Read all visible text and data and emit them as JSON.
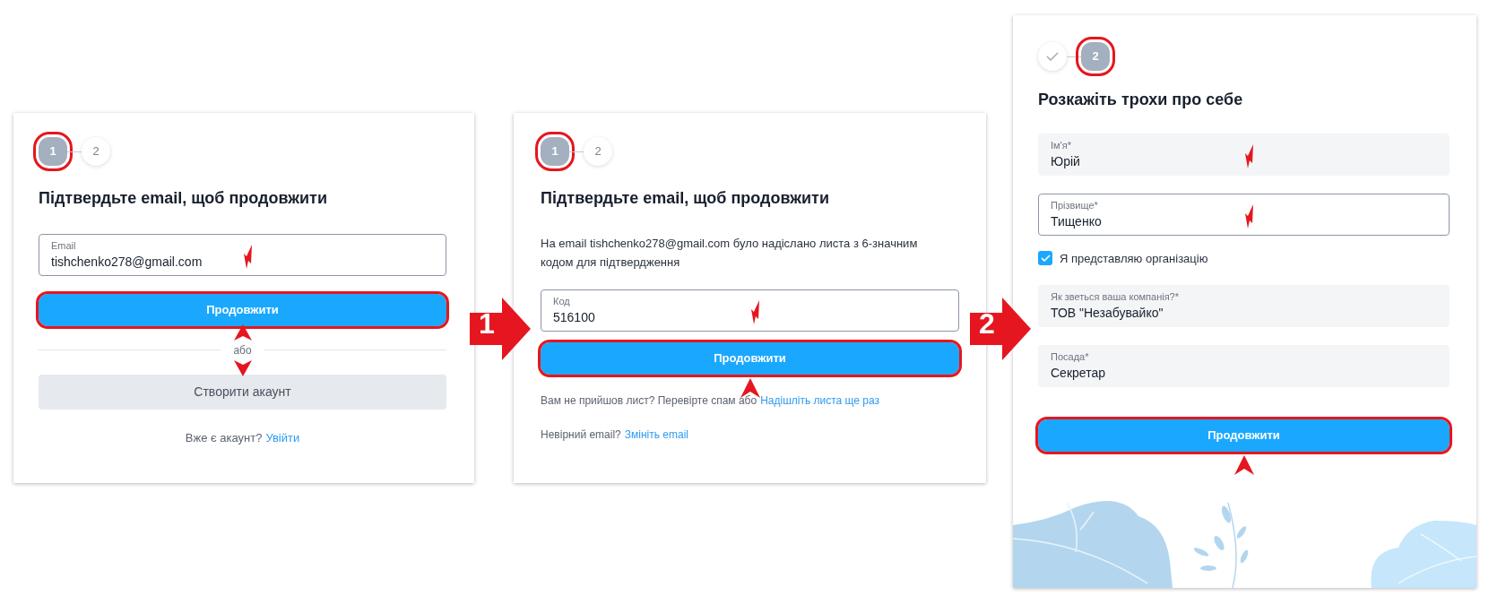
{
  "panels": [
    {
      "steps": [
        {
          "label": "1",
          "current": true,
          "done": false,
          "highlighted": true
        },
        {
          "label": "2",
          "current": false,
          "done": false,
          "highlighted": false
        }
      ],
      "title": "Підтвердьте email, щоб продовжити",
      "blocks": [
        {
          "kind": "field",
          "focused": true,
          "label": "Email",
          "value": "tishchenko278@gmail.com",
          "marked": true
        },
        {
          "kind": "primary_button",
          "label": "Продовжити",
          "highlighted": true,
          "pointer": false
        },
        {
          "kind": "divider",
          "label": "або",
          "annotated": true
        },
        {
          "kind": "secondary_button",
          "label": "Створити акаунт"
        },
        {
          "kind": "link_line",
          "text": "Вже є акаунт?",
          "link": "Увійти"
        }
      ]
    },
    {
      "steps": [
        {
          "label": "1",
          "current": true,
          "done": false,
          "highlighted": true
        },
        {
          "label": "2",
          "current": false,
          "done": false,
          "highlighted": false
        }
      ],
      "title": "Підтвердьте email, щоб продовжити",
      "blocks": [
        {
          "kind": "paragraph",
          "text": "На email tishchenko278@gmail.com було надіслано листа з 6-значним кодом для підтвердження"
        },
        {
          "kind": "field",
          "focused": true,
          "label": "Код",
          "value": "516100",
          "marked": true
        },
        {
          "kind": "primary_button",
          "label": "Продовжити",
          "highlighted": true,
          "pointer": true
        },
        {
          "kind": "link_line",
          "text": "Вам не прийшов лист? Перевірте спам або",
          "link": "Надішліть листа ще раз"
        },
        {
          "kind": "link_line",
          "text": "Невірний email?",
          "link": "Змініть email"
        }
      ]
    },
    {
      "steps": [
        {
          "current": false,
          "done": true,
          "highlighted": false
        },
        {
          "label": "2",
          "current": true,
          "done": false,
          "highlighted": true
        }
      ],
      "title": "Розкажіть трохи про себе",
      "blocks": [
        {
          "kind": "field",
          "focused": false,
          "label": "Ім'я*",
          "value": "Юрій",
          "marked": true
        },
        {
          "kind": "field",
          "focused": true,
          "label": "Прізвище*",
          "value": "Тищенко",
          "marked": true
        },
        {
          "kind": "checkbox",
          "label": "Я представляю організацію",
          "checked": true
        },
        {
          "kind": "field",
          "focused": false,
          "label": "Як зветься ваша компанія?*",
          "value": "ТОВ \"Незабувайко\"",
          "marked": false
        },
        {
          "kind": "field",
          "focused": false,
          "label": "Посада*",
          "value": "Секретар",
          "marked": false
        },
        {
          "kind": "primary_button",
          "label": "Продовжити",
          "highlighted": true,
          "pointer": true
        }
      ],
      "illustration": true
    }
  ],
  "connectors": [
    {
      "label": "1"
    },
    {
      "label": "2"
    }
  ]
}
